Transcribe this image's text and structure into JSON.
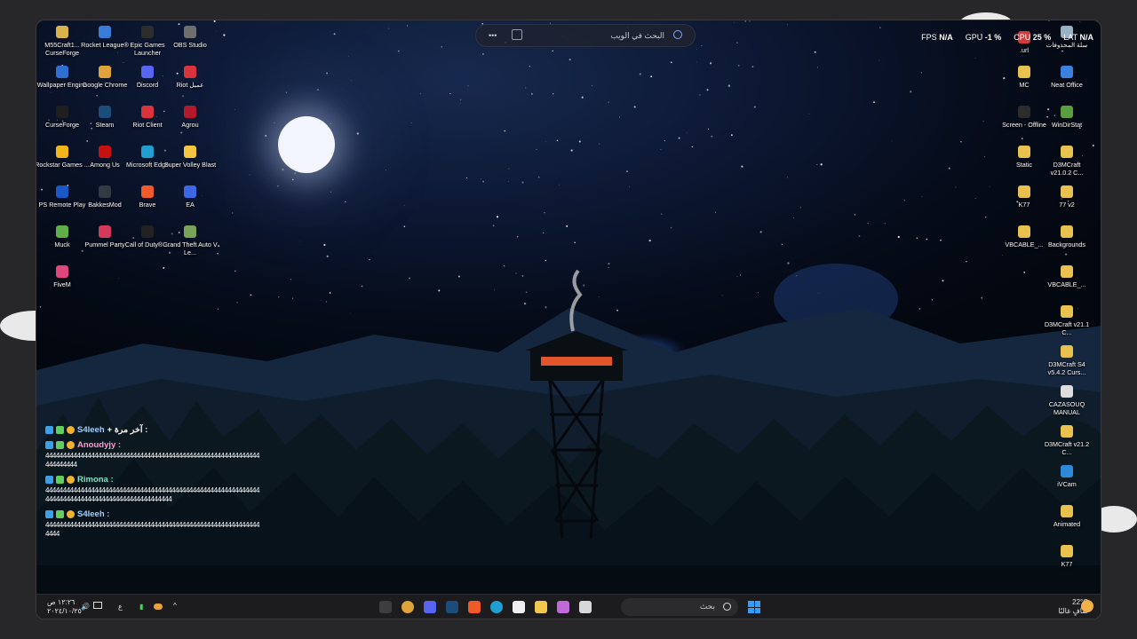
{
  "search": {
    "placeholder": "البحث في الويب",
    "more": "•••",
    "scan_icon": "scan-icon",
    "search_icon": "search-icon"
  },
  "stats": {
    "fps_label": "FPS",
    "fps_value": "N/A",
    "gpu_label": "GPU",
    "gpu_value": "-1 %",
    "cpu_label": "CPU",
    "cpu_value": "25 %",
    "lat_label": "LAT",
    "lat_value": "N/A"
  },
  "left_icons": [
    {
      "label": "M55Craft1... CurseForge",
      "color": "#d8b24a"
    },
    {
      "label": "Rocket League®",
      "color": "#3a7bd5"
    },
    {
      "label": "Epic Games Launcher",
      "color": "#2d2d2d"
    },
    {
      "label": "OBS Studio",
      "color": "#6e6e6e"
    },
    {
      "label": "Wallpaper Engine",
      "color": "#2f6fd1"
    },
    {
      "label": "Google Chrome",
      "color": "#e0a23a"
    },
    {
      "label": "Discord",
      "color": "#5865f2"
    },
    {
      "label": "Riot عميل",
      "color": "#d9343d"
    },
    {
      "label": "CurseForge",
      "color": "#1f1f1f"
    },
    {
      "label": "Steam",
      "color": "#1b4c7a"
    },
    {
      "label": "Riot Client",
      "color": "#d9343d"
    },
    {
      "label": "Agrou",
      "color": "#b2192b"
    },
    {
      "label": "Rockstar Games ...",
      "color": "#f3b51b"
    },
    {
      "label": "Among Us",
      "color": "#c51111"
    },
    {
      "label": "Microsoft Edge",
      "color": "#1fa0d0"
    },
    {
      "label": "Super Volley Blast",
      "color": "#f5c542"
    },
    {
      "label": "PS Remote Play",
      "color": "#1c57c6"
    },
    {
      "label": "BakkesMod",
      "color": "#333a44"
    },
    {
      "label": "Brave",
      "color": "#f05a28"
    },
    {
      "label": "EA",
      "color": "#3e68e3"
    },
    {
      "label": "Muck",
      "color": "#5fae4a"
    },
    {
      "label": "Pummel Party",
      "color": "#d13a5b"
    },
    {
      "label": "Call of Duty® ...",
      "color": "#222222"
    },
    {
      "label": "Grand Theft Auto V Le...",
      "color": "#7aa35a"
    },
    {
      "label": "FiveM",
      "color": "#e0457b"
    }
  ],
  "right_icons": [
    {
      "label": "سلة المحذوفات",
      "color": "#9ab0c4"
    },
    {
      "label": ".url",
      "color": "#d23b3b"
    },
    {
      "label": "MC",
      "color": "#e8c14f"
    },
    {
      "label": "Neat Office",
      "color": "#3b82e0"
    },
    {
      "label": "Screen - Offline",
      "color": "#2c2c2c"
    },
    {
      "label": "WinDirStat",
      "color": "#5a9e3f"
    },
    {
      "label": "Static",
      "color": "#e8c14f"
    },
    {
      "label": "D3MCraft v21.0.2 C...",
      "color": "#e8c14f"
    },
    {
      "label": "K77",
      "color": "#e8c14f"
    },
    {
      "label": "77 v2",
      "color": "#e8c14f"
    },
    {
      "label": "VBCABLE_...",
      "color": "#e8c14f"
    },
    {
      "label": "Backgrounds",
      "color": "#e8c14f"
    },
    {
      "label": "VBCABLE_...",
      "color": "#e8c14f"
    },
    {
      "label": "D3MCraft v21.1 C...",
      "color": "#e8c14f"
    },
    {
      "label": "D3MCraft S4 v5.4.2 Curs...",
      "color": "#e8c14f"
    },
    {
      "label": "CAZASOUQ MANUAL",
      "color": "#dddddd"
    },
    {
      "label": "D3MCraft v21.2 C...",
      "color": "#e8c14f"
    },
    {
      "label": "iVCam",
      "color": "#2e8ad8"
    },
    {
      "label": "Animated",
      "color": "#e8c14f"
    },
    {
      "label": "K77",
      "color": "#e8c14f"
    }
  ],
  "chat": [
    {
      "user": "S4leeh",
      "suffix": "+ آخر مرة :",
      "user_color": "#9fd0ff",
      "message": ""
    },
    {
      "user": "Anoudyjy :",
      "suffix": "",
      "user_color": "#ff9bd1",
      "message": "4444444444444444444444444444444444444444444444444444444444444444444444"
    },
    {
      "user": "Rimona :",
      "suffix": "",
      "user_color": "#7fe3c4",
      "message": "4444444444444444444444444444444444444444444444444444444444444444444444444444444444444444444444444"
    },
    {
      "user": "S4leeh :",
      "suffix": "",
      "user_color": "#9fd0ff",
      "message": "44444444444444444444444444444444444444444444444444444444444444444"
    }
  ],
  "taskbar": {
    "search_text": "بحث",
    "time": "١٢:٢٦ ص",
    "date": "٢٠٢٤/١٠/٢٥",
    "lang": "ع",
    "weather_temp": "22°C",
    "weather_text": "صافٍ غالبًا",
    "icons": [
      {
        "name": "obs-icon",
        "color": "#3d3d3d"
      },
      {
        "name": "chrome-icon",
        "color": "#e0a23a"
      },
      {
        "name": "discord-icon",
        "color": "#5865f2"
      },
      {
        "name": "steam-icon",
        "color": "#1b4c7a"
      },
      {
        "name": "brave-icon",
        "color": "#f05a28"
      },
      {
        "name": "edge-icon",
        "color": "#1fa0d0"
      },
      {
        "name": "store-icon",
        "color": "#f0f0f0"
      },
      {
        "name": "file-explorer-icon",
        "color": "#f2c94c"
      },
      {
        "name": "copilot-icon",
        "color": "#c06ad8"
      },
      {
        "name": "window-icon",
        "color": "#d8d8d8"
      }
    ]
  }
}
